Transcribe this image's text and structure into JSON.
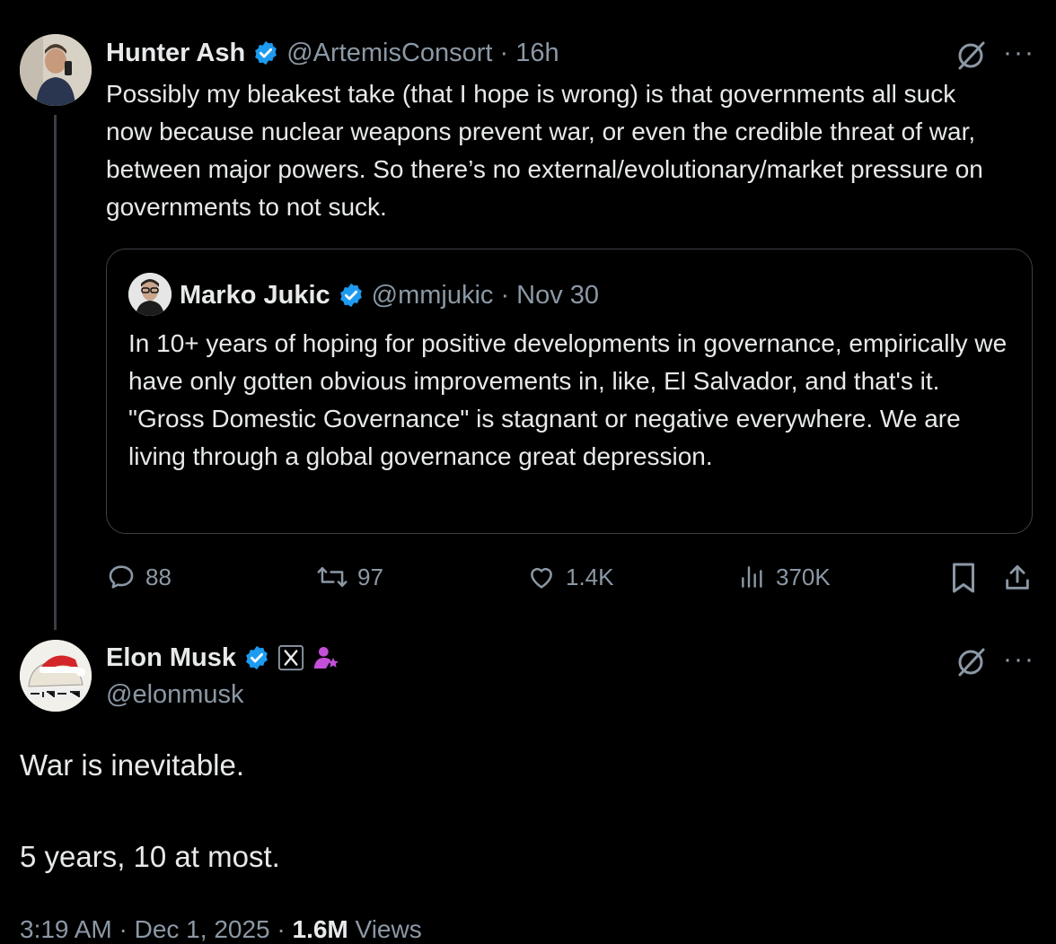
{
  "main_tweet": {
    "author_name": "Hunter Ash",
    "handle_time": "@ArtemisConsort · 16h",
    "text": "Possibly my bleakest take (that I hope is wrong) is that governments all suck now because nuclear weapons prevent war, or even the credible threat of war, between major powers. So there’s no external/evolutionary/market pressure on governments to not suck.",
    "quoted": {
      "author_name": "Marko Jukic",
      "handle_time": "@mmjukic · Nov 30",
      "text": "In 10+ years of hoping for positive developments in governance, empirically we have only gotten obvious improvements in, like, El Salvador, and that's it. \"Gross Domestic Governance\" is stagnant or negative everywhere. We are living through a global governance great depression."
    },
    "actions": {
      "replies": "88",
      "reposts": "97",
      "likes": "1.4K",
      "views": "370K"
    }
  },
  "reply_tweet": {
    "author_name": "Elon Musk",
    "handle": "@elonmusk",
    "line1": "War is inevitable.",
    "line2": "5 years, 10 at most.",
    "footer": {
      "time_date": "3:19 AM · Dec 1, 2025 · ",
      "views_count": "1.6M",
      "views_label": " Views"
    }
  },
  "more_label": "···",
  "colors": {
    "background": "#000000",
    "text": "#e7e9ea",
    "secondary": "#8b98a5",
    "verified": "#1d9bf0",
    "badge_pink": "#c44fd8"
  }
}
